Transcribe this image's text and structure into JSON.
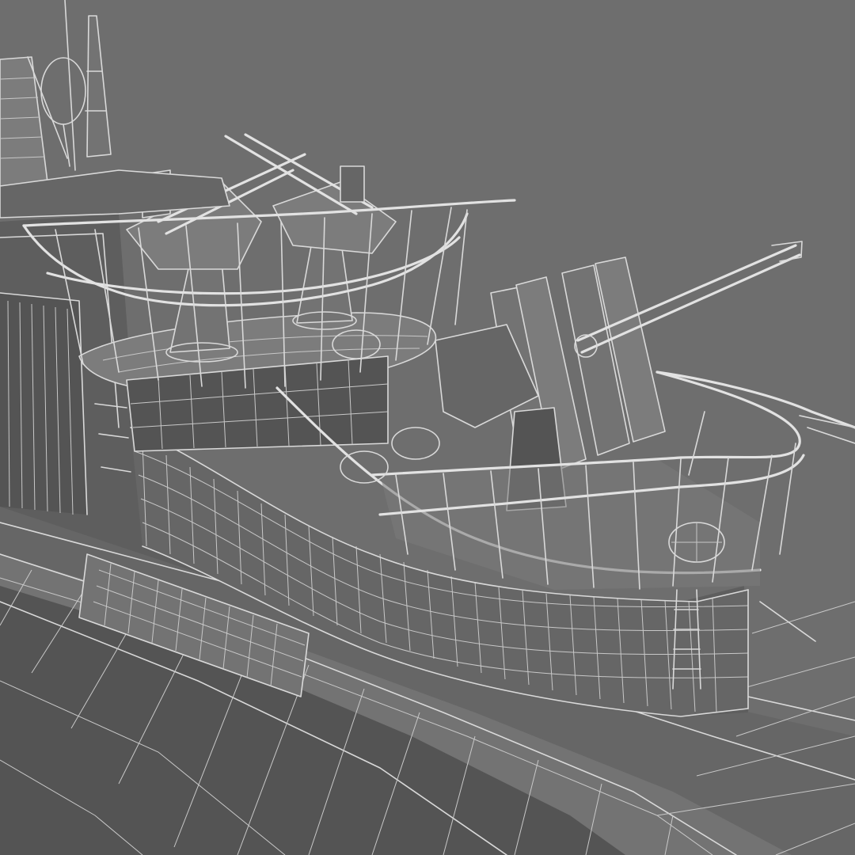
{
  "image": {
    "subject": "",
    "colors": {
      "background": "#6e6e6e",
      "wireframe": "#d9d9d9",
      "hull_dark": "#545454",
      "hull_mid": "#666666",
      "deck_light": "#7c7c7c"
    }
  }
}
